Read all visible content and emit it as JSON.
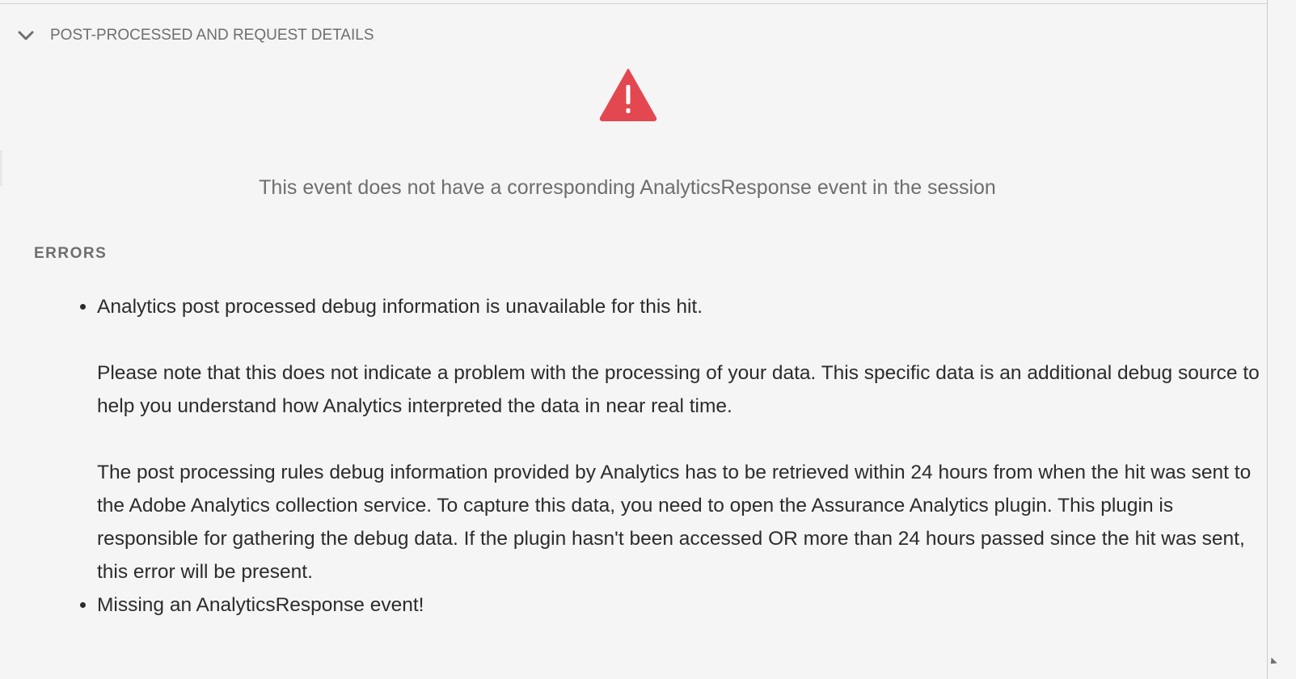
{
  "section": {
    "title": "POST-PROCESSED AND REQUEST DETAILS",
    "expanded": true,
    "icon": "chevron-down-icon"
  },
  "warning": {
    "icon": "warning-triangle-icon",
    "color": "#e34850"
  },
  "notice": "This event does not have a corresponding AnalyticsResponse event in the session",
  "errors": {
    "heading": "ERRORS",
    "items": [
      {
        "paragraphs": [
          "Analytics post processed debug information is unavailable for this hit.",
          "Please note that this does not indicate a problem with the processing of your data. This specific data is an additional debug source to help you understand how Analytics interpreted the data in near real time.",
          "The post processing rules debug information provided by Analytics has to be retrieved within 24 hours from when the hit was sent to the Adobe Analytics collection service. To capture this data, you need to open the Assurance Analytics plugin. This plugin is responsible for gathering the debug data. If the plugin hasn't been accessed OR more than 24 hours passed since the hit was sent, this error will be present."
        ]
      },
      {
        "paragraphs": [
          "Missing an AnalyticsResponse event!"
        ]
      }
    ]
  }
}
